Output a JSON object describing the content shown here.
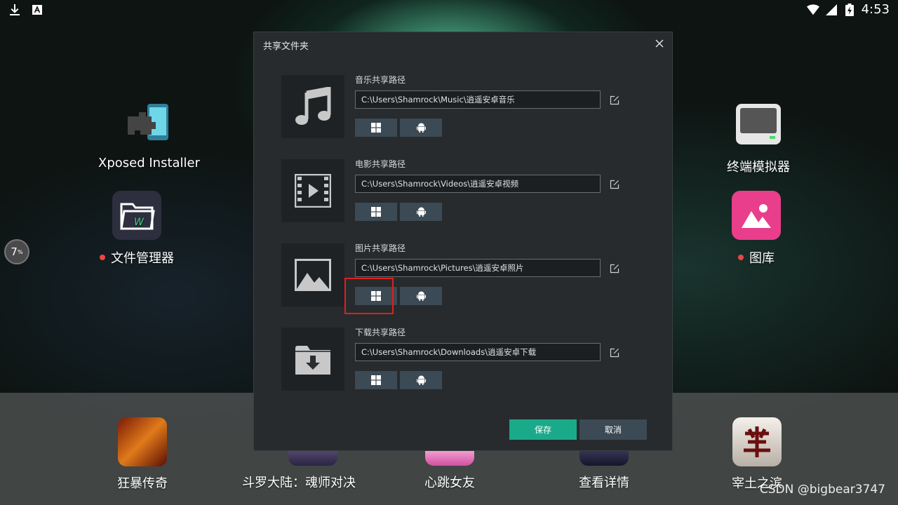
{
  "status_bar": {
    "time": "4:53"
  },
  "left_badge": {
    "value": "7",
    "unit": "%"
  },
  "desktop": {
    "xposed": {
      "label": "Xposed Installer"
    },
    "file_manager": {
      "label": "文件管理器"
    },
    "terminal": {
      "label": "终端模拟器"
    },
    "gallery": {
      "label": "图库"
    }
  },
  "dock": {
    "apps": [
      {
        "label": "狂暴传奇"
      },
      {
        "label": "斗罗大陆：魂师对决"
      },
      {
        "label": "心跳女友"
      },
      {
        "label": "查看详情"
      },
      {
        "label": "宰土之滨"
      }
    ]
  },
  "watermark": "CSDN @bigbear3747",
  "dialog": {
    "title": "共享文件夹",
    "sections": [
      {
        "label": "音乐共享路径",
        "path": "C:\\Users\\Shamrock\\Music\\逍遥安卓音乐",
        "icon": "music-icon"
      },
      {
        "label": "电影共享路径",
        "path": "C:\\Users\\Shamrock\\Videos\\逍遥安卓视频",
        "icon": "film-icon"
      },
      {
        "label": "图片共享路径",
        "path": "C:\\Users\\Shamrock\\Pictures\\逍遥安卓照片",
        "icon": "image-icon"
      },
      {
        "label": "下载共享路径",
        "path": "C:\\Users\\Shamrock\\Downloads\\逍遥安卓下载",
        "icon": "download-folder-icon"
      }
    ],
    "save_label": "保存",
    "cancel_label": "取消",
    "accent_color": "#1aaa8a",
    "highlight_color": "#e02020"
  }
}
